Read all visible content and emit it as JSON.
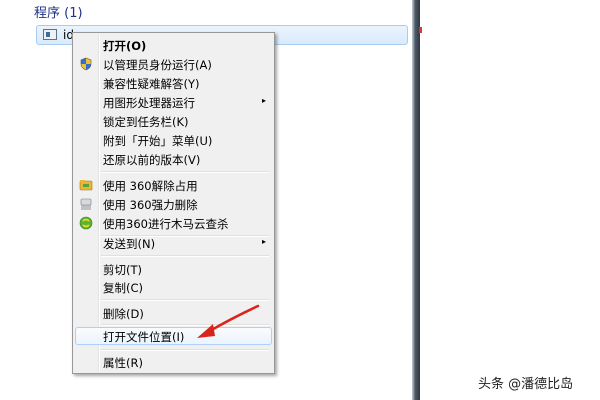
{
  "results": {
    "section_title": "程序 (1)",
    "program_name": "id…"
  },
  "context_menu": {
    "items": [
      {
        "label": "打开(O)",
        "bold": true
      },
      {
        "label": "以管理员身份运行(A)",
        "icon": "uac-shield-icon"
      },
      {
        "label": "兼容性疑难解答(Y)"
      },
      {
        "label": "用图形处理器运行",
        "submenu": true
      },
      {
        "label": "锁定到任务栏(K)"
      },
      {
        "label": "附到「开始」菜单(U)"
      },
      {
        "label": "还原以前的版本(V)"
      },
      {
        "label": "使用 360解除占用",
        "icon": "360-unlock-icon"
      },
      {
        "label": "使用 360强力删除",
        "icon": "360-shred-icon"
      },
      {
        "label": "使用360进行木马云查杀",
        "icon": "360-scan-icon"
      },
      {
        "label": "发送到(N)",
        "submenu": true
      },
      {
        "label": "剪切(T)"
      },
      {
        "label": "复制(C)"
      },
      {
        "label": "删除(D)"
      },
      {
        "label": "打开文件位置(I)",
        "highlighted": true
      },
      {
        "label": "属性(R)"
      }
    ],
    "submenu_arrow": "▸"
  },
  "watermark": "头条 @潘德比岛",
  "colors": {
    "highlight_border": "#aecff7",
    "annotation_red": "#d9261c",
    "section_title": "#1e3287"
  }
}
